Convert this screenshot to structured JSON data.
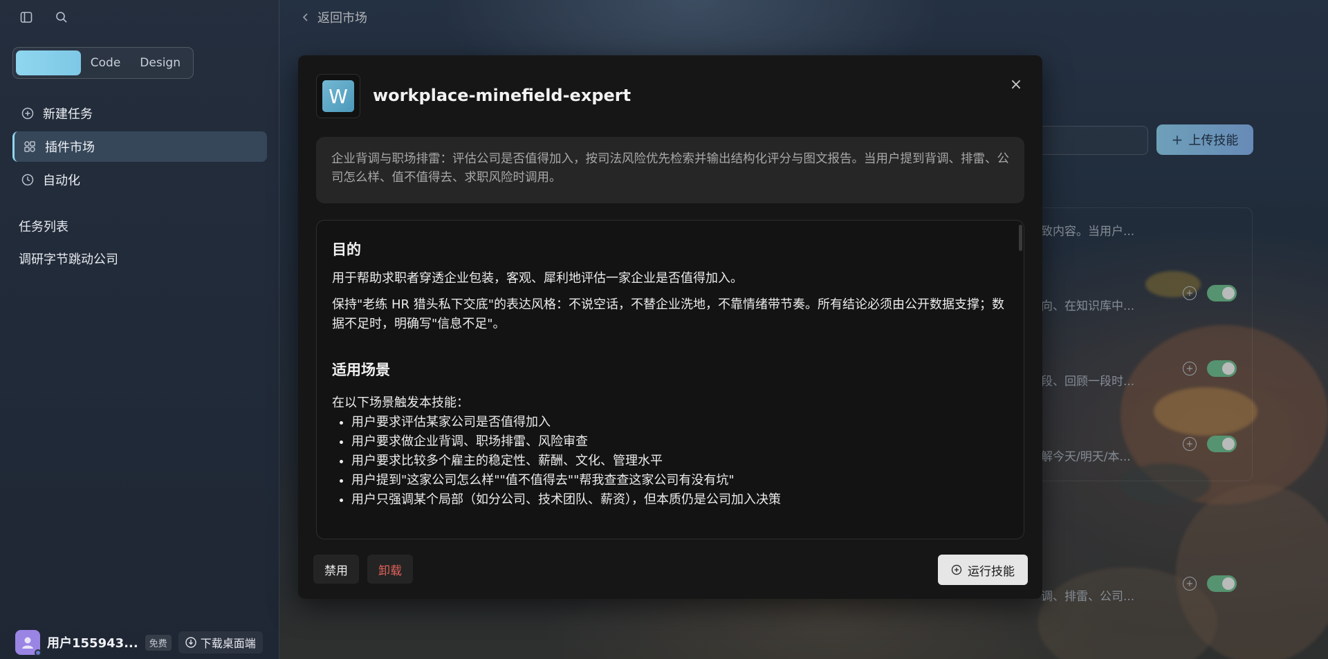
{
  "app": {
    "mode_switch": {
      "active_label": "",
      "code": "Code",
      "design": "Design"
    },
    "nav": [
      {
        "label": "新建任务",
        "icon": "plus-circle-icon"
      },
      {
        "label": "插件市场",
        "icon": "puzzle-icon"
      },
      {
        "label": "自动化",
        "icon": "clock-icon"
      }
    ],
    "sections": {
      "task_list": "任务列表",
      "task_item": "调研字节跳动公司"
    },
    "footer": {
      "username": "用户155943...",
      "plan": "免费",
      "download": "下载桌面端"
    }
  },
  "market": {
    "back_label": "返回市场",
    "upload_label": "上传技能",
    "rows": [
      {
        "snippet": "致内容。当用户..."
      },
      {
        "snippet": "向、在知识库中..."
      },
      {
        "snippet": "段、回顾一段时..."
      },
      {
        "snippet": "解今天/明天/本..."
      },
      {
        "snippet": "调、排雷、公司..."
      }
    ]
  },
  "modal": {
    "logo_letter": "W",
    "title": "workplace-minefield-expert",
    "close": "×",
    "description": "企业背调与职场排雷：评估公司是否值得加入，按司法风险优先检索并输出结构化评分与图文报告。当用户提到背调、排雷、公司怎么样、值不值得去、求职风险时调用。",
    "sections": {
      "purpose_title": "目的",
      "purpose_p1": "用于帮助求职者穿透企业包装，客观、犀利地评估一家企业是否值得加入。",
      "purpose_p2": "保持\"老练 HR 猎头私下交底\"的表达风格：不说空话，不替企业洗地，不靠情绪带节奏。所有结论必须由公开数据支撑；数据不足时，明确写\"信息不足\"。",
      "scenes_title": "适用场景",
      "scenes_intro": "在以下场景触发本技能：",
      "scenes": [
        "用户要求评估某家公司是否值得加入",
        "用户要求做企业背调、职场排雷、风险审查",
        "用户要求比较多个雇主的稳定性、薪酬、文化、管理水平",
        "用户提到\"这家公司怎么样\"\"值不值得去\"\"帮我查查这家公司有没有坑\"",
        "用户只强调某个局部（如分公司、技术团队、薪资），但本质仍是公司加入决策"
      ]
    },
    "buttons": {
      "disable": "禁用",
      "uninstall": "卸载",
      "run": "运行技能"
    }
  }
}
